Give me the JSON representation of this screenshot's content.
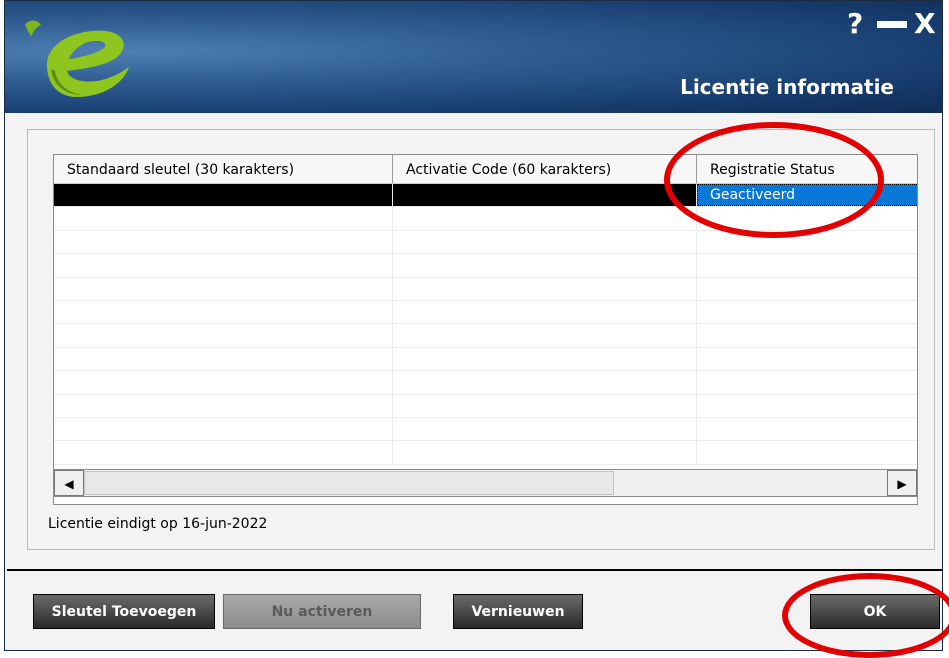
{
  "window": {
    "title": "Licentie informatie",
    "controls": {
      "help": "?",
      "close": "X"
    },
    "logo": "e-logo"
  },
  "table": {
    "columns": [
      "Standaard sleutel (30 karakters)",
      "Activatie Code (60 karakters)",
      "Registratie Status"
    ],
    "rows": [
      {
        "key": "",
        "code": "",
        "status": "Geactiveerd",
        "selected": true
      }
    ],
    "empty_rows": 11
  },
  "scrollbar": {
    "left_icon": "◀",
    "right_icon": "▶"
  },
  "license": {
    "expiry_text": "Licentie eindigt op 16-jun-2022"
  },
  "buttons": {
    "add_key": "Sleutel Toevoegen",
    "activate": "Nu activeren",
    "renew": "Vernieuwen",
    "ok": "OK"
  },
  "colors": {
    "titlebar": "#173c6d",
    "selection": "#0a78d7",
    "annotation": "#e30000",
    "logo_green": "#8fc51f"
  }
}
